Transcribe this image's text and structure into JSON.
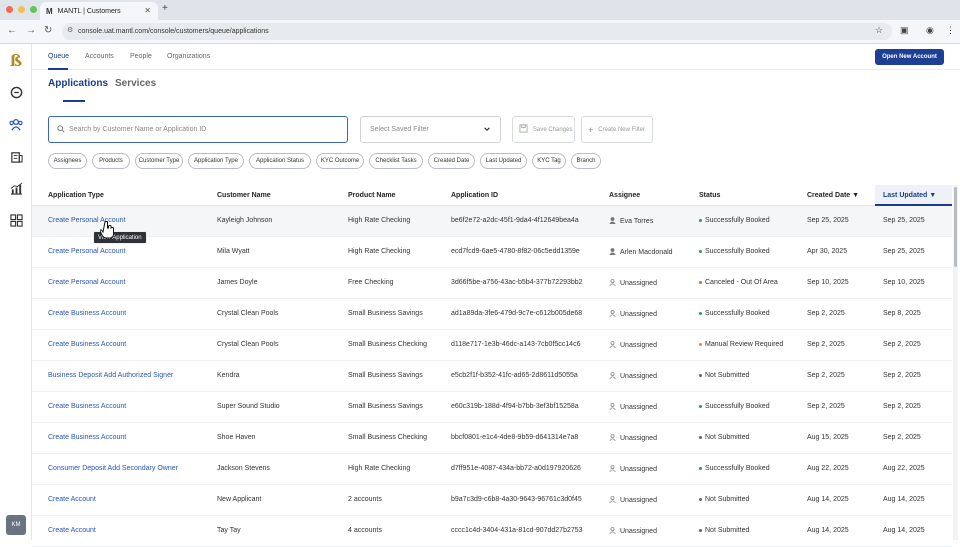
{
  "browser": {
    "tab_title": "MANTL | Customers",
    "tab_favicon": "M",
    "url": "console.uat.mantl.com/console/customers/queue/applications"
  },
  "rail": {
    "avatar_initials": "KM",
    "icons": [
      "logo",
      "chat-icon",
      "people-icon",
      "bank-icon",
      "chart-icon",
      "grid-icon"
    ]
  },
  "topnav": {
    "items": [
      "Queue",
      "Accounts",
      "People",
      "Organizations"
    ],
    "primary_button": "Open New Account"
  },
  "subtabs": [
    "Applications",
    "Services"
  ],
  "filters": {
    "search_placeholder": "Search by Customer Name or Application ID",
    "saved_filter_placeholder": "Select Saved Filter",
    "save_changes": "Save Changes",
    "create_filter": "Create New Filter",
    "chips": [
      "Assignees",
      "Products",
      "Customer Type",
      "Application Type",
      "Application Status",
      "KYC Outcome",
      "Checklist Tasks",
      "Created Date",
      "Last Updated",
      "KYC Tag",
      "Branch"
    ]
  },
  "table": {
    "headers": [
      "Application Type",
      "Customer Name",
      "Product Name",
      "Application ID",
      "Assignee",
      "Status",
      "Created Date",
      "Last Updated"
    ],
    "rows": [
      {
        "type": "Create Personal Account",
        "customer": "Kayleigh Johnson",
        "product": "High Rate Checking",
        "app_id": "be6f2e72-a2dc-45f1-9da4-4f12649bea4a",
        "assignee": "Eva Torres",
        "status": "Successfully Booked",
        "created": "Sep 25, 2025",
        "updated": "Sep 25, 2025"
      },
      {
        "type": "Create Personal Account",
        "customer": "Mila Wyatt",
        "product": "High Rate Checking",
        "app_id": "ecd7fcd9-6ae5-4780-8f82-06c5edd1359e",
        "assignee": "Arlen Macdonald",
        "status": "Successfully Booked",
        "created": "Apr 30, 2025",
        "updated": "Sep 25, 2025"
      },
      {
        "type": "Create Personal Account",
        "customer": "James Doyle",
        "product": "Free Checking",
        "app_id": "3d66f5be-a756-43ac-b5b4-377b72293bb2",
        "assignee": "Unassigned",
        "status": "Canceled - Out Of Area",
        "created": "Sep 10, 2025",
        "updated": "Sep 10, 2025"
      },
      {
        "type": "Create Business Account",
        "customer": "Crystal Clean Pools",
        "product": "Small Business Savings",
        "app_id": "ad1a89da-3fe6-479d-9c7e-c612b005de68",
        "assignee": "Unassigned",
        "status": "Successfully Booked",
        "created": "Sep 2, 2025",
        "updated": "Sep 8, 2025"
      },
      {
        "type": "Create Business Account",
        "customer": "Crystal Clean Pools",
        "product": "Small Business Checking",
        "app_id": "d118e717-1e3b-46dc-a143-7cb0f5cc14c6",
        "assignee": "Unassigned",
        "status": "Manual Review Required",
        "created": "Sep 2, 2025",
        "updated": "Sep 2, 2025"
      },
      {
        "type": "Business Deposit Add Authorized Signer",
        "customer": "Kendra",
        "product": "Small Business Savings",
        "app_id": "e5cb2f1f-b352-41fc-ad65-2d8611d5055a",
        "assignee": "Unassigned",
        "status": "Not Submitted",
        "created": "Sep 2, 2025",
        "updated": "Sep 2, 2025"
      },
      {
        "type": "Create Business Account",
        "customer": "Super Sound Studio",
        "product": "Small Business Savings",
        "app_id": "e60c319b-188d-4f94-b7bb-3ef3bf15258a",
        "assignee": "Unassigned",
        "status": "Successfully Booked",
        "created": "Sep 2, 2025",
        "updated": "Sep 2, 2025"
      },
      {
        "type": "Create Business Account",
        "customer": "Shoe Haven",
        "product": "Small Business Checking",
        "app_id": "bbcf0801-e1c4-4de8-9b59-d641314e7a8",
        "assignee": "Unassigned",
        "status": "Not Submitted",
        "created": "Aug 15, 2025",
        "updated": "Sep 2, 2025"
      },
      {
        "type": "Consumer Deposit Add Secondary Owner",
        "customer": "Jackson Stevens",
        "product": "High Rate Checking",
        "app_id": "d7ff951e-4087-434a-bb72-a0d197920626",
        "assignee": "Unassigned",
        "status": "Successfully Booked",
        "created": "Aug 22, 2025",
        "updated": "Aug 22, 2025"
      },
      {
        "type": "Create Account",
        "customer": "New Applicant",
        "product": "2 accounts",
        "app_id": "b9a7c3d9-c6b8-4a30-9643-96761c3d0f45",
        "assignee": "Unassigned",
        "status": "Not Submitted",
        "created": "Aug 14, 2025",
        "updated": "Aug 14, 2025"
      },
      {
        "type": "Create Account",
        "customer": "Tay Tay",
        "product": "4 accounts",
        "app_id": "cccc1c4d-3404-431a-81cd-907dd27b2753",
        "assignee": "Unassigned",
        "status": "Not Submitted",
        "created": "Aug 14, 2025",
        "updated": "Aug 14, 2025"
      }
    ]
  },
  "tooltip": "View Application",
  "colors": {
    "brand": "#1a3d8f",
    "link": "#2a55b8",
    "status_booked": "#2e9e5b",
    "status_canceled": "#e0672c",
    "status_review": "#e0932c",
    "status_not_submitted": "#666666"
  }
}
